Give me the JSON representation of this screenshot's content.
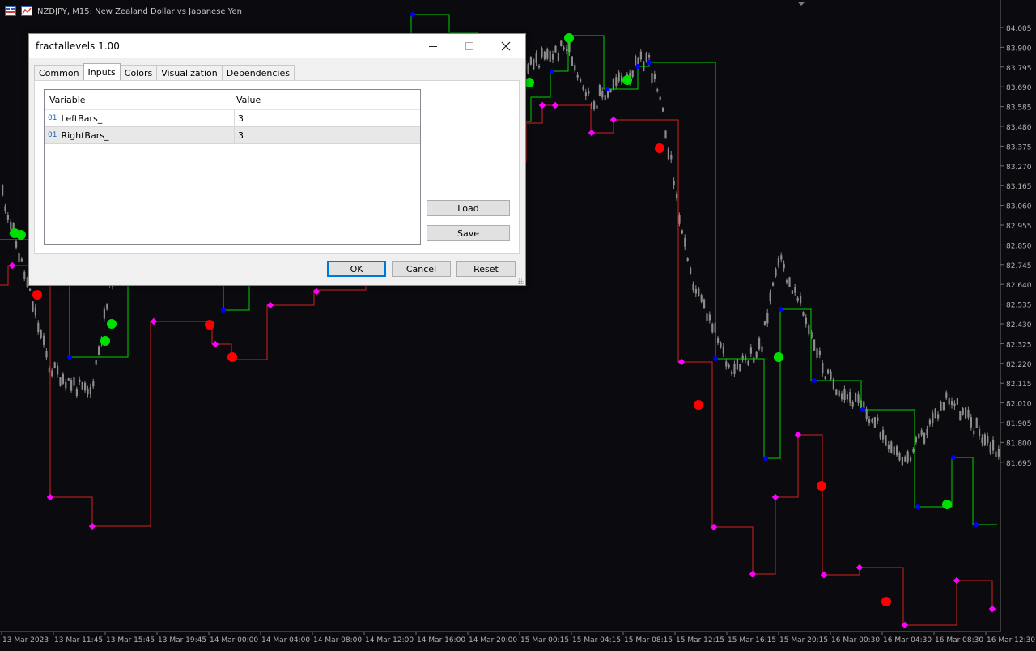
{
  "chart": {
    "symbol_title": "NZDJPY, M15:  New Zealand Dollar vs Japanese Yen",
    "price_levels": [
      "84.005",
      "83.900",
      "83.795",
      "83.690",
      "83.585",
      "83.480",
      "83.375",
      "83.270",
      "83.165",
      "83.060",
      "82.955",
      "82.850",
      "82.745",
      "82.640",
      "82.535",
      "82.430",
      "82.325",
      "82.220",
      "82.115",
      "82.010",
      "81.905",
      "81.800",
      "81.695"
    ],
    "time_labels": [
      "13 Mar 2023",
      "13 Mar 11:45",
      "13 Mar 15:45",
      "13 Mar 19:45",
      "14 Mar 00:00",
      "14 Mar 04:00",
      "14 Mar 08:00",
      "14 Mar 12:00",
      "14 Mar 16:00",
      "14 Mar 20:00",
      "15 Mar 00:15",
      "15 Mar 04:15",
      "15 Mar 08:15",
      "15 Mar 12:15",
      "15 Mar 16:15",
      "15 Mar 20:15",
      "16 Mar 00:30",
      "16 Mar 04:30",
      "16 Mar 08:30",
      "16 Mar 12:30"
    ],
    "colors": {
      "background": "#0b0b0f",
      "candle": "#8c8c8c",
      "upper_line": "#00d000",
      "lower_line": "#d42020",
      "upper_fractal": "#0000ff",
      "lower_fractal": "#ff00ff",
      "buy_signal": "#00e000",
      "sell_signal": "#ff0000",
      "axis_text": "#b4b4b4"
    }
  },
  "dialog": {
    "title": "fractallevels 1.00",
    "tabs": [
      {
        "label": "Common",
        "active": false
      },
      {
        "label": "Inputs",
        "active": true
      },
      {
        "label": "Colors",
        "active": false
      },
      {
        "label": "Visualization",
        "active": false
      },
      {
        "label": "Dependencies",
        "active": false
      }
    ],
    "grid": {
      "headers": {
        "variable": "Variable",
        "value": "Value"
      },
      "rows": [
        {
          "type": "01",
          "variable": "LeftBars_",
          "value": "3"
        },
        {
          "type": "01",
          "variable": "RightBars_",
          "value": "3"
        }
      ]
    },
    "buttons": {
      "load": "Load",
      "save": "Save",
      "ok": "OK",
      "cancel": "Cancel",
      "reset": "Reset"
    },
    "window_controls": {
      "minimize": "minimize",
      "maximize": "maximize",
      "close": "close"
    }
  }
}
